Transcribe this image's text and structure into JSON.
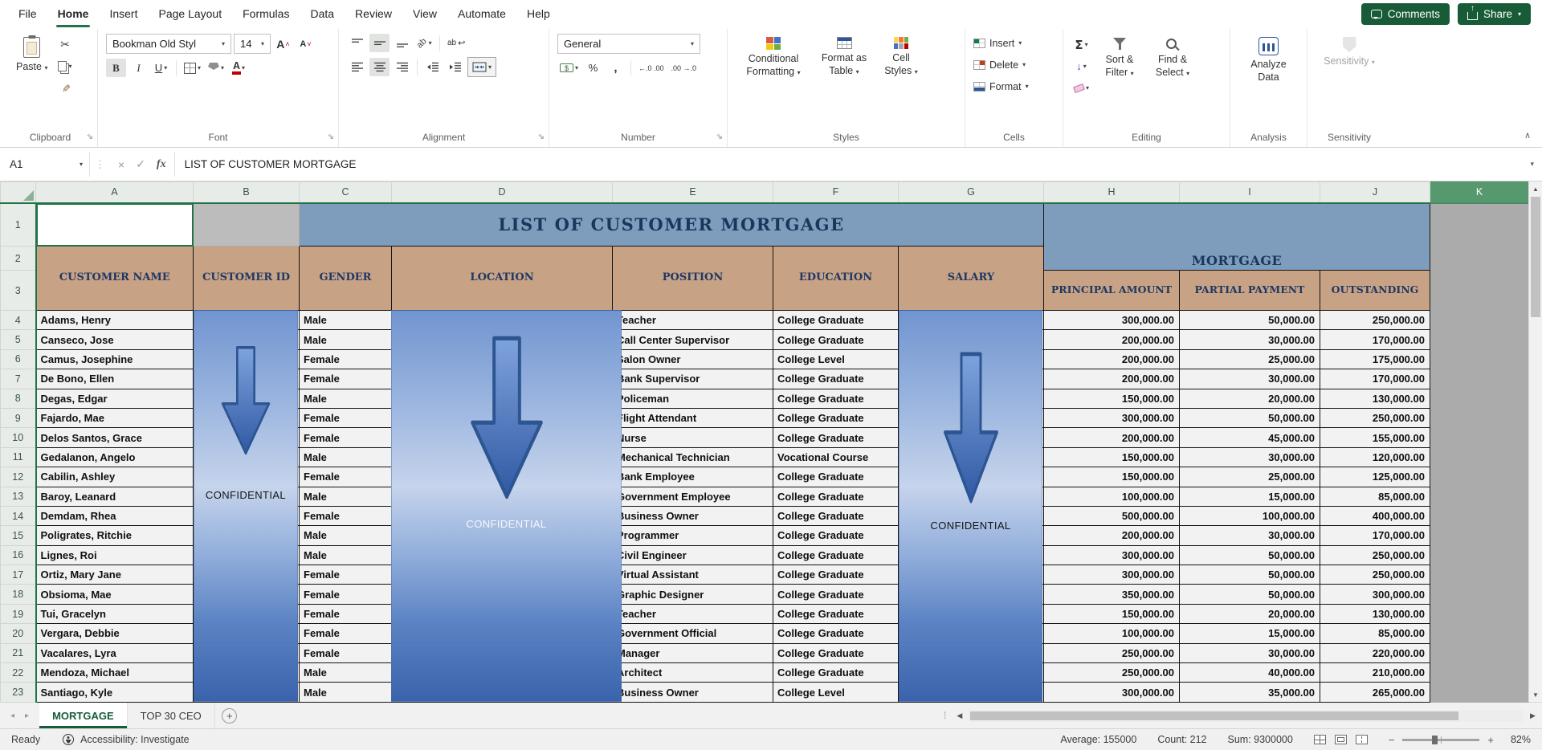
{
  "ribbon": {
    "tabs": [
      "File",
      "Home",
      "Insert",
      "Page Layout",
      "Formulas",
      "Data",
      "Review",
      "View",
      "Automate",
      "Help"
    ],
    "active_tab": "Home",
    "comments_label": "Comments",
    "share_label": "Share",
    "clipboard": {
      "label": "Clipboard",
      "paste": "Paste"
    },
    "font": {
      "label": "Font",
      "font_name": "Bookman Old Styl",
      "font_size": "14",
      "bold": "B",
      "italic": "I",
      "underline": "U"
    },
    "alignment": {
      "label": "Alignment"
    },
    "number": {
      "label": "Number",
      "format": "General"
    },
    "styles": {
      "label": "Styles",
      "conditional": "Conditional Formatting",
      "format_table": "Format as Table",
      "cell_styles": "Cell Styles"
    },
    "cells": {
      "label": "Cells",
      "insert": "Insert",
      "delete": "Delete",
      "format": "Format"
    },
    "editing": {
      "label": "Editing",
      "sort_filter": "Sort & Filter",
      "find_select": "Find & Select"
    },
    "analysis": {
      "label": "Analysis",
      "analyze": "Analyze Data"
    },
    "sensitivity": {
      "label": "Sensitivity",
      "button": "Sensitivity"
    }
  },
  "formula_bar": {
    "name_box": "A1",
    "fx_label": "fx",
    "content": "LIST OF CUSTOMER MORTGAGE"
  },
  "sheet": {
    "columns": [
      "A",
      "B",
      "C",
      "D",
      "E",
      "F",
      "G",
      "H",
      "I",
      "J",
      "K"
    ],
    "visible_row_count": 23,
    "title": "LIST OF CUSTOMER MORTGAGE",
    "mortgage_header": "MORTGAGE",
    "column_headers": [
      "CUSTOMER NAME",
      "CUSTOMER ID",
      "GENDER",
      "LOCATION",
      "POSITION",
      "EDUCATION",
      "SALARY"
    ],
    "mortgage_sub_headers": [
      "PRINCIPAL AMOUNT",
      "PARTIAL PAYMENT",
      "OUTSTANDING"
    ],
    "confidential_label": "CONFIDENTIAL",
    "rows": [
      {
        "name": "Adams, Henry",
        "gender": "Male",
        "position": "Teacher",
        "education": "College Graduate",
        "principal": "300,000.00",
        "partial": "50,000.00",
        "outstanding": "250,000.00"
      },
      {
        "name": "Canseco, Jose",
        "gender": "Male",
        "position": "Call Center Supervisor",
        "education": "College Graduate",
        "principal": "200,000.00",
        "partial": "30,000.00",
        "outstanding": "170,000.00"
      },
      {
        "name": "Camus, Josephine",
        "gender": "Female",
        "position": "Salon Owner",
        "education": "College Level",
        "principal": "200,000.00",
        "partial": "25,000.00",
        "outstanding": "175,000.00"
      },
      {
        "name": "De Bono, Ellen",
        "gender": "Female",
        "position": "Bank Supervisor",
        "education": "College Graduate",
        "principal": "200,000.00",
        "partial": "30,000.00",
        "outst anding": "170,000.00",
        "outstanding": "170,000.00"
      },
      {
        "name": "Degas, Edgar",
        "gender": "Male",
        "position": "Policeman",
        "education": "College Graduate",
        "principal": "150,000.00",
        "partial": "20,000.00",
        "outstanding": "130,000.00"
      },
      {
        "name": "Fajardo, Mae",
        "gender": "Female",
        "position": "Flight Attendant",
        "education": "College Graduate",
        "principal": "300,000.00",
        "partial": "50,000.00",
        "outstanding": "250,000.00"
      },
      {
        "name": "Delos Santos, Grace",
        "gender": "Female",
        "position": "Nurse",
        "education": "College Graduate",
        "principal": "200,000.00",
        "partial": "45,000.00",
        "outstanding": "155,000.00"
      },
      {
        "name": "Gedalanon, Angelo",
        "gender": "Male",
        "position": "Mechanical Technician",
        "education": "Vocational Course",
        "principal": "150,000.00",
        "partial": "30,000.00",
        "outstanding": "120,000.00"
      },
      {
        "name": "Cabilin, Ashley",
        "gender": "Female",
        "position": "Bank Employee",
        "education": "College Graduate",
        "principal": "150,000.00",
        "partial": "25,000.00",
        "outstanding": "125,000.00"
      },
      {
        "name": "Baroy, Leanard",
        "gender": "Male",
        "position": "Government Employee",
        "education": "College Graduate",
        "principal": "100,000.00",
        "partial": "15,000.00",
        "outstanding": "85,000.00"
      },
      {
        "name": "Demdam, Rhea",
        "gender": "Female",
        "position": "Business Owner",
        "education": "College Graduate",
        "principal": "500,000.00",
        "partial": "100,000.00",
        "outstanding": "400,000.00"
      },
      {
        "name": "Poligrates, Ritchie",
        "gender": "Male",
        "position": "Programmer",
        "education": "College Graduate",
        "principal": "200,000.00",
        "partial": "30,000.00",
        "outstanding": "170,000.00"
      },
      {
        "name": "Lignes, Roi",
        "gender": "Male",
        "position": "Civil Engineer",
        "education": "College Graduate",
        "principal": "300,000.00",
        "partial": "50,000.00",
        "outstanding": "250,000.00"
      },
      {
        "name": "Ortiz, Mary Jane",
        "gender": "Female",
        "position": "Virtual Assistant",
        "education": "College Graduate",
        "principal": "300,000.00",
        "partial": "50,000.00",
        "outstanding": "250,000.00"
      },
      {
        "name": "Obsioma, Mae",
        "gender": "Female",
        "position": "Graphic Designer",
        "education": "College Graduate",
        "principal": "350,000.00",
        "partial": "50,000.00",
        "outstanding": "300,000.00"
      },
      {
        "name": "Tui, Gracelyn",
        "gender": "Female",
        "position": "Teacher",
        "education": "College Graduate",
        "principal": "150,000.00",
        "partial": "20,000.00",
        "outstanding": "130,000.00"
      },
      {
        "name": "Vergara, Debbie",
        "gender": "Female",
        "position": "Government Official",
        "education": "College Graduate",
        "principal": "100,000.00",
        "partial": "15,000.00",
        "outstanding": "85,000.00"
      },
      {
        "name": "Vacalares, Lyra",
        "gender": "Female",
        "position": "Manager",
        "education": "College Graduate",
        "principal": "250,000.00",
        "partial": "30,000.00",
        "outstanding": "220,000.00"
      },
      {
        "name": "Mendoza, Michael",
        "gender": "Male",
        "position": "Architect",
        "education": "College Graduate",
        "principal": "250,000.00",
        "partial": "40,000.00",
        "outstanding": "210,000.00"
      },
      {
        "name": "Santiago, Kyle",
        "gender": "Male",
        "position": "Business Owner",
        "education": "College Level",
        "principal": "300,000.00",
        "partial": "35,000.00",
        "outstanding": "265,000.00"
      }
    ]
  },
  "sheet_tabs": {
    "tabs": [
      "MORTGAGE",
      "TOP 30 CEO"
    ],
    "active": "MORTGAGE"
  },
  "status_bar": {
    "mode": "Ready",
    "accessibility": "Accessibility: Investigate",
    "average": "Average: 155000",
    "count": "Count: 212",
    "sum": "Sum: 9300000",
    "zoom": "82%"
  },
  "icons": {
    "comments": "speech-bubble",
    "share": "box-up-arrow",
    "cut": "scissors ✂",
    "copy": "overlapping-squares",
    "format_painter": "brush",
    "autosum": "Σ",
    "dropdown": "▾",
    "dialog_launcher": "⇘",
    "confidential_shape": "block-down-arrow",
    "find_select": "magnifier",
    "sort_filter": "funnel"
  },
  "colors": {
    "accent_green": "#217346",
    "title_band": "#7E9DBC",
    "header_tan": "#C8A285",
    "header_text": "#1F3864",
    "shape_blue": "#4472C4",
    "gray_fill": "#ABABAB"
  }
}
